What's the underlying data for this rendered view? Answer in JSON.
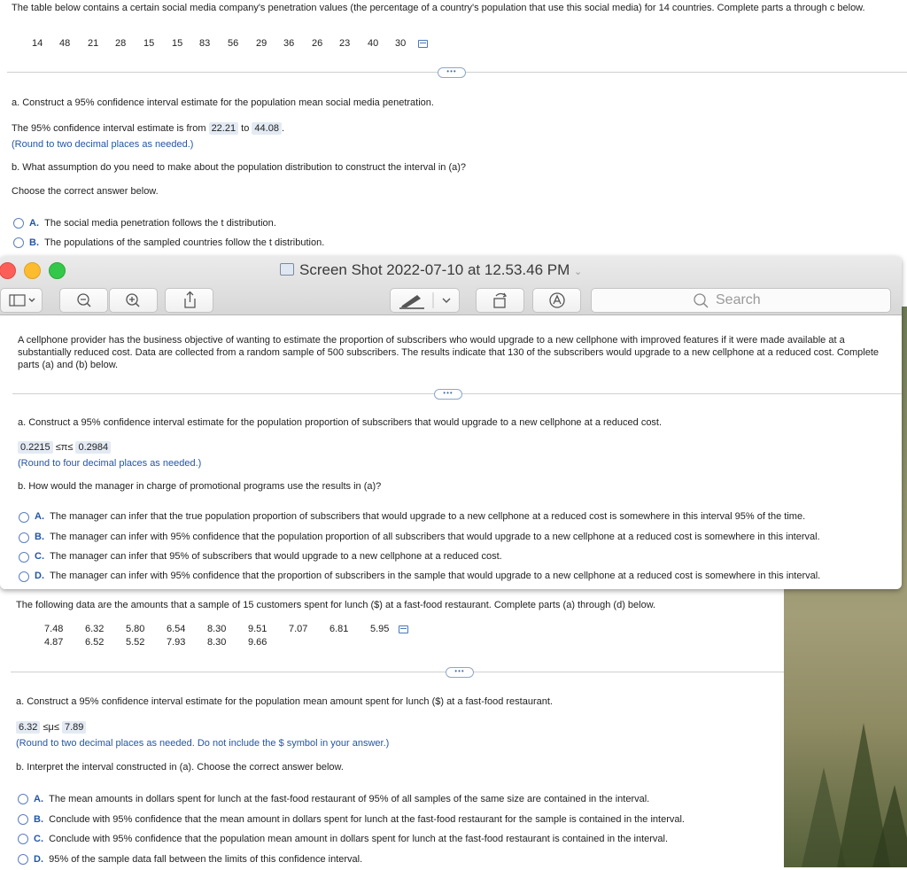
{
  "problem1": {
    "intro": "The table below contains a certain social media company's penetration values (the percentage of a country's population that use this social media) for 14 countries. Complete parts a through c below.",
    "data": [
      "14",
      "48",
      "21",
      "28",
      "15",
      "15",
      "83",
      "56",
      "29",
      "36",
      "26",
      "23",
      "40",
      "30"
    ],
    "a_prompt": "a. Construct a 95% confidence interval estimate for the population mean social media penetration.",
    "a_text_pre": "The 95% confidence interval estimate is from",
    "a_low": "22.21",
    "a_mid": "to",
    "a_high": "44.08",
    "a_end": ".",
    "a_round": "(Round to two decimal places as needed.)",
    "b_prompt": "b. What assumption do you need to make about the population distribution to construct the interval in (a)?",
    "choose": "Choose the correct answer below.",
    "options": [
      {
        "letter": "A.",
        "text": "The social media penetration follows the t distribution."
      },
      {
        "letter": "B.",
        "text": "The populations of the sampled countries follow the t distribution."
      }
    ]
  },
  "window": {
    "title": "Screen Shot 2022-07-10 at 12.53.46 PM",
    "search_placeholder": "Search",
    "colors": {
      "close": "#fc5f57",
      "minimize": "#fdbc2e",
      "zoom": "#34c84a"
    },
    "icons": [
      "sidebar-icon",
      "zoom-out-icon",
      "zoom-in-icon",
      "share-icon",
      "markup-pen-icon",
      "rotate-icon",
      "annotate-icon",
      "search-icon"
    ]
  },
  "problem2": {
    "intro": "A cellphone provider has the business objective of wanting to estimate the proportion of subscribers who would upgrade to a new cellphone with improved features if it were made available at a substantially reduced cost. Data are collected from a random sample of 500 subscribers. The results indicate that 130 of the subscribers would upgrade to a new cellphone at a reduced cost. Complete parts (a) and (b) below.",
    "a_prompt": "a. Construct a 95% confidence interval estimate for the population proportion of subscribers that would upgrade to a new cellphone at a reduced cost.",
    "a_low": "0.2215",
    "a_symbol": "≤π≤",
    "a_high": "0.2984",
    "a_round": "(Round to four decimal places as needed.)",
    "b_prompt": "b. How would the manager in charge of promotional programs use the results in (a)?",
    "options": [
      {
        "letter": "A.",
        "text": "The manager can infer that the true population proportion of subscribers that would upgrade to a new cellphone at a reduced cost is somewhere in this interval 95% of the time."
      },
      {
        "letter": "B.",
        "text": "The manager can infer with 95% confidence that the population proportion of all subscribers that would upgrade to a new cellphone at a reduced cost is somewhere in this interval."
      },
      {
        "letter": "C.",
        "text": "The manager can infer that 95% of subscribers that would upgrade to a new cellphone at a reduced cost."
      },
      {
        "letter": "D.",
        "text": "The manager can infer with 95% confidence that the proportion of subscribers in the sample that would upgrade to a new cellphone at a reduced cost is somewhere in this interval."
      }
    ]
  },
  "problem3": {
    "intro": "The following data are the amounts that a sample of 15 customers spent for lunch ($) at a fast-food restaurant. Complete parts (a) through (d) below.",
    "row1": [
      "7.48",
      "6.32",
      "5.80",
      "6.54",
      "8.30",
      "9.51",
      "7.07",
      "6.81",
      "5.95"
    ],
    "row2": [
      "4.87",
      "6.52",
      "5.52",
      "7.93",
      "8.30",
      "9.66"
    ],
    "a_prompt": "a. Construct a 95% confidence interval estimate for the population mean amount spent for lunch ($) at a fast-food restaurant.",
    "a_low": "6.32",
    "a_symbol": "≤μ≤",
    "a_high": "7.89",
    "a_round": "(Round to two decimal places as needed. Do not include the $ symbol in your answer.)",
    "b_prompt": "b. Interpret the interval constructed in (a). Choose the correct answer below.",
    "options": [
      {
        "letter": "A.",
        "text": "The mean amounts in dollars spent for lunch at the fast-food restaurant of 95% of all samples of the same size are contained in the interval."
      },
      {
        "letter": "B.",
        "text": "Conclude with 95% confidence that the mean amount in dollars spent for lunch at the fast-food restaurant for the sample is contained in the interval."
      },
      {
        "letter": "C.",
        "text": "Conclude with 95% confidence that the population mean amount in dollars spent for lunch at the fast-food restaurant is contained in the interval."
      },
      {
        "letter": "D.",
        "text": "95% of the sample data fall between the limits of this confidence interval."
      }
    ]
  }
}
